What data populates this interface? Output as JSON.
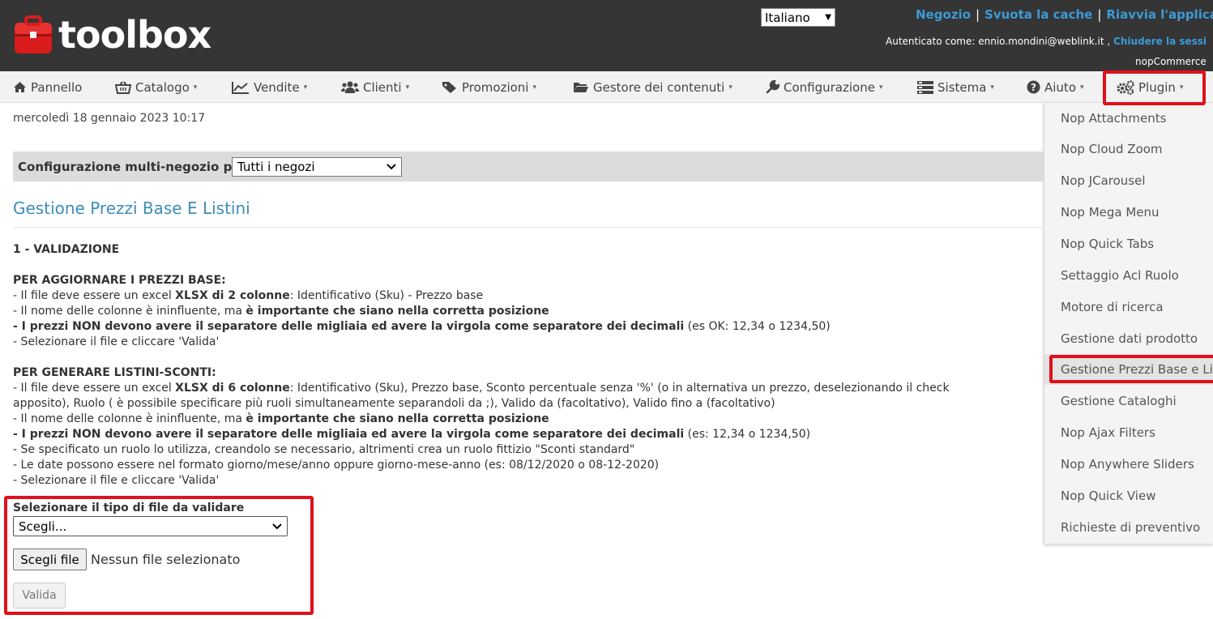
{
  "header": {
    "logo_text": "toolbox",
    "language": "Italiano",
    "links": [
      "Negozio",
      "Svuota la cache",
      "Riavvia l'applicazio"
    ],
    "auth_prefix": "Autenticato come: ennio.mondini@weblink.it ,",
    "logout": "Chiudere la sessi",
    "version": "nopCommerce"
  },
  "nav": {
    "items": [
      {
        "label": "Pannello",
        "icon": "home-icon"
      },
      {
        "label": "Catalogo",
        "icon": "basket-icon"
      },
      {
        "label": "Vendite",
        "icon": "line-chart-icon"
      },
      {
        "label": "Clienti",
        "icon": "users-icon"
      },
      {
        "label": "Promozioni",
        "icon": "tag-icon"
      },
      {
        "label": "Gestore dei contenuti",
        "icon": "folder-icon"
      },
      {
        "label": "Configurazione",
        "icon": "wrench-icon"
      },
      {
        "label": "Sistema",
        "icon": "server-icon"
      },
      {
        "label": "Aiuto",
        "icon": "question-icon"
      },
      {
        "label": "Plugin",
        "icon": "gears-icon"
      }
    ]
  },
  "plugin_menu": {
    "items": [
      "Nop Attachments",
      "Nop Cloud Zoom",
      "Nop JCarousel",
      "Nop Mega Menu",
      "Nop Quick Tabs",
      "Settaggio Acl Ruolo",
      "Motore di ricerca",
      "Gestione dati prodotto",
      "Gestione Prezzi Base e Lis",
      "Gestione Cataloghi",
      "Nop Ajax Filters",
      "Nop Anywhere Sliders",
      "Nop Quick View",
      "Richieste di preventivo"
    ],
    "active_index": 8
  },
  "main": {
    "date": "mercoledì 18 gennaio 2023 10:17",
    "store_label": "Configurazione multi-negozio per",
    "store_value": "Tutti i negozi",
    "title": "Gestione Prezzi Base E Listini",
    "section": "1 - VALIDAZIONE",
    "base": {
      "heading": "PER AGGIORNARE I PREZZI BASE:",
      "l1a": "- Il file deve essere un excel ",
      "l1b": "XLSX di 2 colonne",
      "l1c": ": Identificativo (Sku) - Prezzo base",
      "l2a": "- Il nome delle colonne è ininfluente, ma ",
      "l2b": "è importante che siano nella corretta posizione",
      "l3a": "- I prezzi NON devono avere il separatore delle migliaia ed avere la virgola come separatore dei decimali",
      "l3b": " (es OK: 12,34 o 1234,50)",
      "l4": "- Selezionare il file e cliccare 'Valida'"
    },
    "lists": {
      "heading": "PER GENERARE LISTINI-SCONTI:",
      "l1a": "- Il file deve essere un excel ",
      "l1b": "XLSX di 6 colonne",
      "l1c": ": Identificativo (Sku), Prezzo base, Sconto percentuale senza '%' (o in alternativa un prezzo, deselezionando il check",
      "l1d": "apposito), Ruolo ( è possibile specificare più ruoli simultaneamente separandoli da ;), Valido da (facoltativo), Valido fino a (facoltativo)",
      "l2a": "- Il nome delle colonne è ininfluente, ma ",
      "l2b": "è importante che siano nella corretta posizione",
      "l3a": "- I prezzi NON devono avere il separatore delle migliaia ed avere la virgola come separatore dei decimali",
      "l3b": " (es: 12,34 o 1234,50)",
      "l4": "- Se specificato un ruolo lo utilizza, creandolo se necessario, altrimenti crea un ruolo fittizio \"Sconti standard\"",
      "l5": "- Le date possono essere nel formato giorno/mese/anno oppure giorno-mese-anno (es: 08/12/2020 o 08-12-2020)",
      "l6": "- Selezionare il file e cliccare 'Valida'"
    },
    "form": {
      "type_label": "Selezionare il tipo di file da validare",
      "type_value": "Scegli...",
      "file_button": "Scegli file",
      "file_status": "Nessun file selezionato",
      "submit": "Valida"
    }
  },
  "colors": {
    "header_bg": "#353535",
    "link": "#3c9bd8",
    "title": "#3c8dbc",
    "highlight": "#e0101c"
  }
}
